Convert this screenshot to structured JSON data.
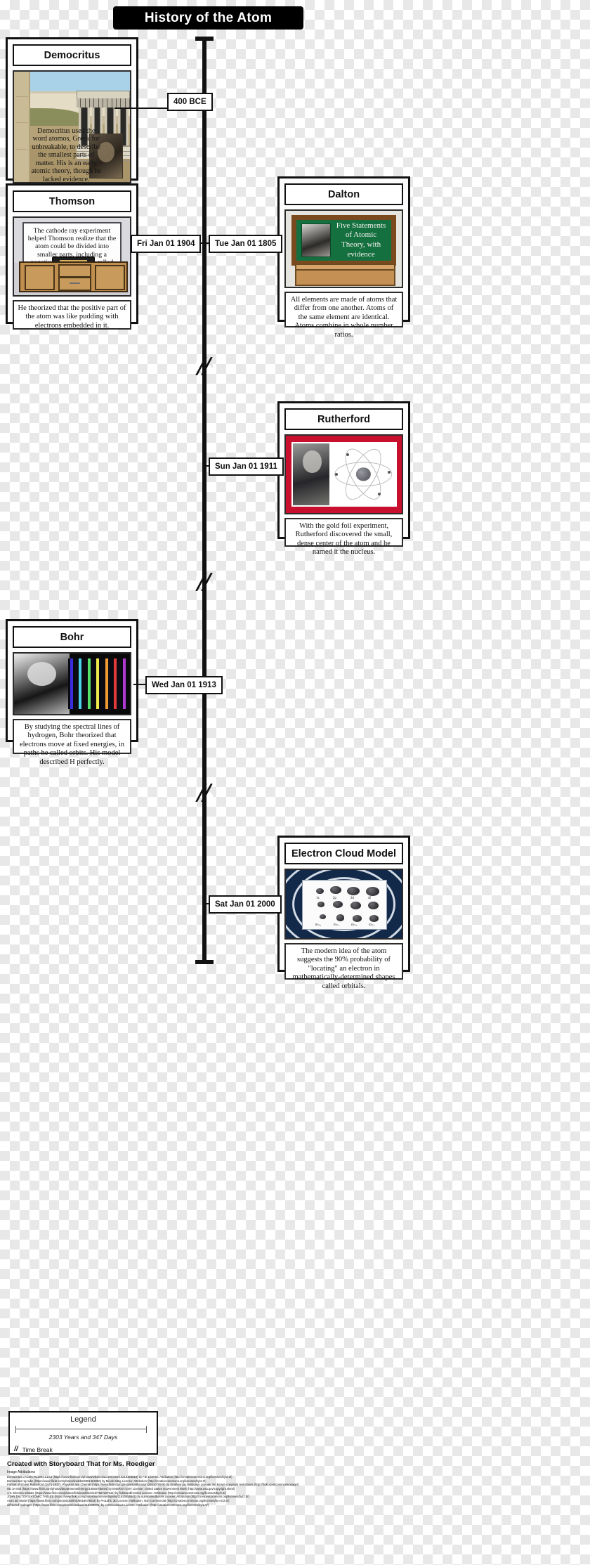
{
  "title": "History of the Atom",
  "timeline": {
    "dates": [
      {
        "id": "democritus",
        "label": "400 BCE"
      },
      {
        "id": "thomson",
        "label": "Fri Jan 01 1904"
      },
      {
        "id": "dalton",
        "label": "Tue Jan 01 1805"
      },
      {
        "id": "rutherford",
        "label": "Sun Jan 01 1911"
      },
      {
        "id": "bohr",
        "label": "Wed Jan 01 1913"
      },
      {
        "id": "electron_cloud",
        "label": "Sat Jan 01 2000"
      }
    ]
  },
  "cards": {
    "democritus": {
      "title": "Democritus",
      "scene_text": "Democritus used the word atomos, Greek for unbreakable, to describe the smallest parts of matter. His is an early atomic theory, though he lacked evidence."
    },
    "thomson": {
      "title": "Thomson",
      "scene_text": "The cathode ray experiment helped Thomson realize that the atom could be divided into smaller parts, including a negatively charged part called the electron.",
      "caption": "He theorized that the positive part of the atom was like pudding with electrons embedded in it."
    },
    "dalton": {
      "title": "Dalton",
      "board_text": "Five Statements of Atomic Theory, with evidence",
      "caption": "All elements are made of atoms that differ from one another. Atoms of the same element are identical. Atoms combine in whole number ratios."
    },
    "rutherford": {
      "title": "Rutherford",
      "caption": "With the gold foil experiment, Rutherford discovered the small, dense center of the atom and he named it the nucleus."
    },
    "bohr": {
      "title": "Bohr",
      "caption": "By studying the spectral lines of hydrogen, Bohr theorized that electrons move at fixed energies, in paths he called orbits. His model described H perfectly."
    },
    "electron_cloud": {
      "title": "Electron Cloud Model",
      "caption": "The modern idea of the atom suggests the 90% probability of \"locating\" an electron in mathematically-determined shapes called orbitals.",
      "orbital_labels": [
        "1s",
        "2p",
        "3d",
        "4f"
      ],
      "orbital_sublabels": [
        "m₌₀",
        "m₌₁",
        "m₌₂",
        "m₌₃"
      ]
    }
  },
  "legend": {
    "title": "Legend",
    "span_label": "2303 Years and 347 Days",
    "break_glyph": "//",
    "break_label": "Time Break"
  },
  "footer": {
    "credit": "Created with Storyboard That for Ms. Roediger",
    "attribution_heading": "Image Attributions",
    "attribution_lines": [
      "Democritus LACMA AC1993.213.2 (https://www.flickr.com/photos/wikimediacommons/16216393818) by Fæ License: Attribution (http://creativecommons.org/licenses/by/2.0/)",
      "Democritus ray tube (https://www.flickr.com/photos/matlibs/5901464050) by Micah Sittig License: Attribution (http://creativecommons.org/licenses/by/2.0/)",
      "Portrait of Ernest Rutherford (1871-1937), Physicist and Chemist (https://www.flickr.com/photos/smithsonian/2551070939) by Smithsonian Institution License: No known copyright restrictions (http://flickr.com/commons/usage/)",
      "HD 3A 002 (https://www.flickr.com/photos/departmentofenergy/10555706494) by ENERGY.GOV License: United States Government Work (http://www.usa.gov/copyright.shtml)",
      "1-3. Electron  orbitals (https://www.flickr.com/photos/fickleandfreckled/7927227544) by fickleandfreckled License: Attribution (http://creativecommons.org/licenses/by/2.0/)",
      "JOHN DALTON'S ATOMIC TABLES (https://www.flickr.com/photos/summonedbyfells/11930855541) by summonedbyfells License: Attribution (http://creativecommons.org/licenses/by/2.0/)",
      "Atom 3D Model (https://www.flickr.com/photos/prolithic/6616679503) by ProLithic 3D License: Attribution, Non Commercial (http://creativecommons.org/licenses/by-nc/2.0/)",
      "diffracted hydrogen (https://www.flickr.com/photos/candace/315205005) by cosmicandace License: Attribution (http://creativecommons.org/licenses/by/2.0/)"
    ]
  }
}
